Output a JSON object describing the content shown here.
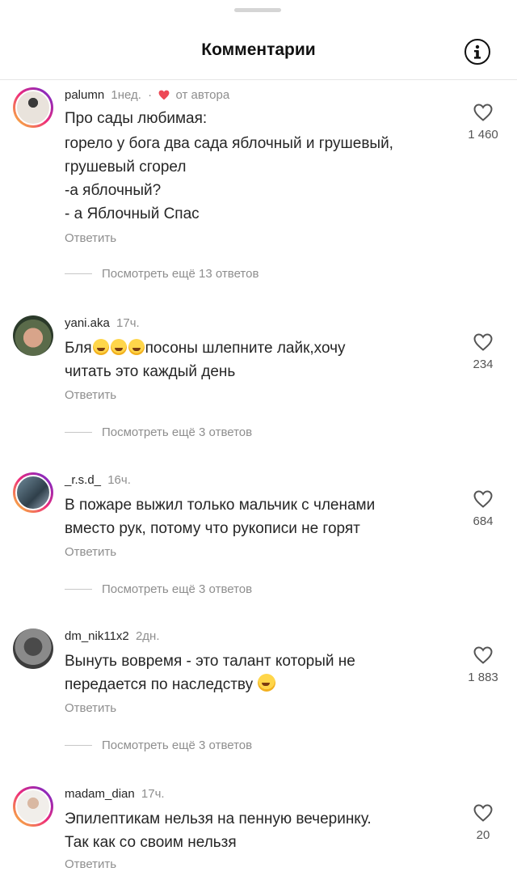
{
  "header": {
    "title": "Комментарии"
  },
  "comments": [
    {
      "username": "palumn",
      "time": "1нед.",
      "dot": "·",
      "author_label": "от автора",
      "lines": [
        "Про сады любимая:",
        "горело у бога два сада яблочный и грушевый,",
        "грушевый сгорел",
        "-а яблочный?",
        "- а Яблочный Спас"
      ],
      "reply": "Ответить",
      "likes": "1 460",
      "view_more": "Посмотреть ещё 13 ответов"
    },
    {
      "username": "yani.aka",
      "time": "17ч.",
      "line1_start": "Бля",
      "line1_end": "посоны шлепните лайк,хочу",
      "line2": "читать это каждый день",
      "emoji": "face-with-tears-of-joy",
      "reply": "Ответить",
      "likes": "234",
      "view_more": "Посмотреть ещё 3 ответов"
    },
    {
      "username": "_r.s.d_",
      "time": "16ч.",
      "lines": [
        "В пожаре выжил только мальчик с членами",
        "вместо рук, потому что рукописи не горят"
      ],
      "reply": "Ответить",
      "likes": "684",
      "view_more": "Посмотреть ещё 3 ответов"
    },
    {
      "username": "dm_nik11x2",
      "time": "2дн.",
      "line1": "Вынуть вовремя - это талант который не",
      "line2": "передается по наследству",
      "emoji": "grinning-face-with-sweat",
      "reply": "Ответить",
      "likes": "1 883",
      "view_more": "Посмотреть ещё 3 ответов"
    },
    {
      "username": "madam_dian",
      "time": "17ч.",
      "lines": [
        "Эпилептикам нельзя на пенную вечеринку.",
        "Так как со своим нельзя"
      ],
      "reply": "Ответить",
      "likes": "20"
    }
  ],
  "colors": {
    "text": "#262626",
    "muted": "#8e8e8e",
    "author_heart": "#ed4956"
  },
  "icons": {
    "info": "info-icon",
    "like": "heart-outline-icon",
    "author_like": "heart-filled-icon"
  }
}
